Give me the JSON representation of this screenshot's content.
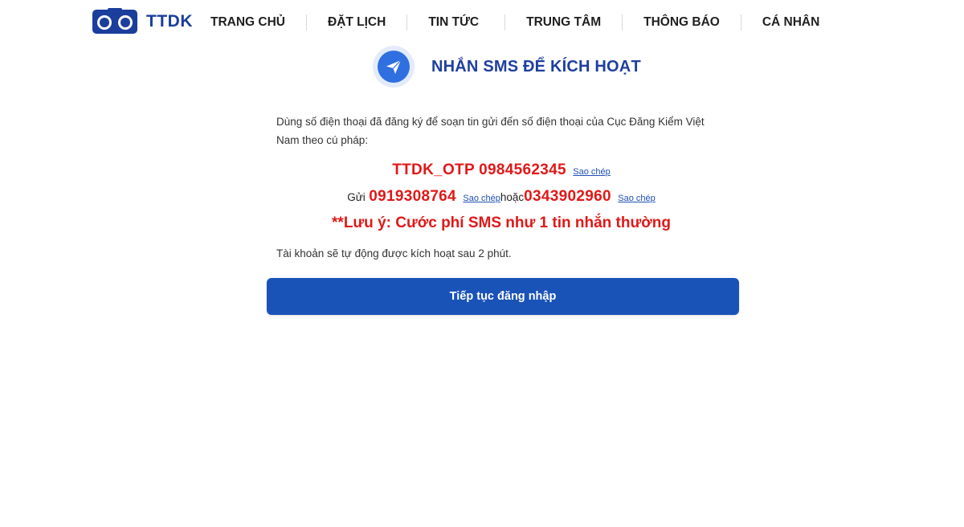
{
  "app": {
    "logo_text": "TTDK",
    "accent_color": "#1a53b8",
    "warning_color": "#e01818"
  },
  "nav": {
    "items": [
      {
        "label": "TRANG CHỦ"
      },
      {
        "label": "ĐẶT LỊCH"
      },
      {
        "label": "TIN TỨC"
      },
      {
        "label": "TRUNG TÂM"
      },
      {
        "label": "THÔNG BÁO"
      },
      {
        "label": "CÁ NHÂN"
      }
    ]
  },
  "heading": {
    "icon": "send-icon",
    "title": "NHẮN SMS ĐỂ KÍCH HOẠT"
  },
  "content": {
    "instructions": "Dùng số điện thoại đã đăng ký để soạn tin gửi đến số điện thoại của Cục Đăng Kiểm Việt Nam theo cú pháp:",
    "syntax": "TTDK_OTP 0984562345",
    "copy_label": "Sao chép",
    "send_label": "Gửi",
    "phone_1": "0919308764",
    "or_label": "hoặc",
    "phone_2": "0343902960",
    "note": "**Lưu ý: Cước phí SMS như 1 tin nhắn thường",
    "activation_text": "Tài khoản sẽ tự động được kích hoạt sau 2 phút."
  },
  "button": {
    "continue_label": "Tiếp tục đăng nhập"
  }
}
